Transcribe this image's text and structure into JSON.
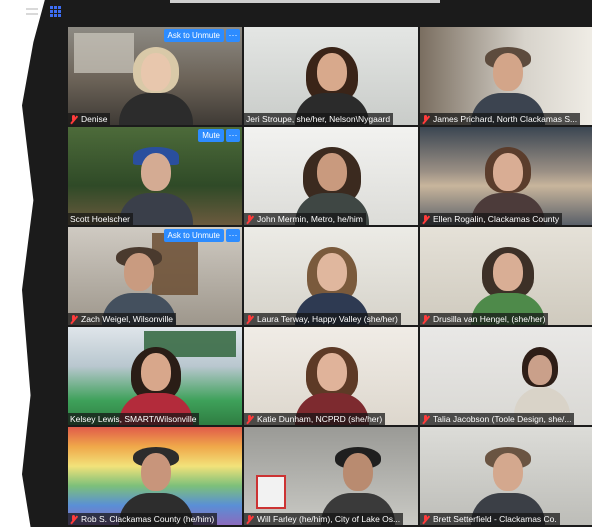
{
  "toolbar": {
    "icons": [
      "minimize-icon",
      "grid-view-icon"
    ]
  },
  "tile_controls": {
    "ask_to_unmute": "Ask to Unmute",
    "mute": "Mute",
    "more": "···"
  },
  "participants": [
    {
      "name": "Denise",
      "muted": true
    },
    {
      "name": "Jeri Stroupe, she/her, Nelson\\Nygaard",
      "muted": false
    },
    {
      "name": "James Prichard, North Clackamas S...",
      "muted": true
    },
    {
      "name": "Scott Hoelscher",
      "muted": false
    },
    {
      "name": "John Mermin, Metro, he/him",
      "muted": true
    },
    {
      "name": "Ellen Rogalin, Clackamas County",
      "muted": true
    },
    {
      "name": "Zach Weigel, Wilsonville",
      "muted": true
    },
    {
      "name": "Laura Terway, Happy Valley (she/her)",
      "muted": true
    },
    {
      "name": "Drusilla van Hengel, (she/her)",
      "muted": true
    },
    {
      "name": "Kelsey Lewis, SMART/Wilsonville",
      "muted": false
    },
    {
      "name": "Katie Dunham, NCPRD (she/her)",
      "muted": true
    },
    {
      "name": "Talia Jacobson (Toole Design, she/...",
      "muted": true
    },
    {
      "name": "Rob S. Clackamas County (he/him)",
      "muted": true
    },
    {
      "name": "Will Farley (he/him), City of Lake Os...",
      "muted": true
    },
    {
      "name": "Brett Setterfield - Clackamas Co.",
      "muted": true
    }
  ]
}
